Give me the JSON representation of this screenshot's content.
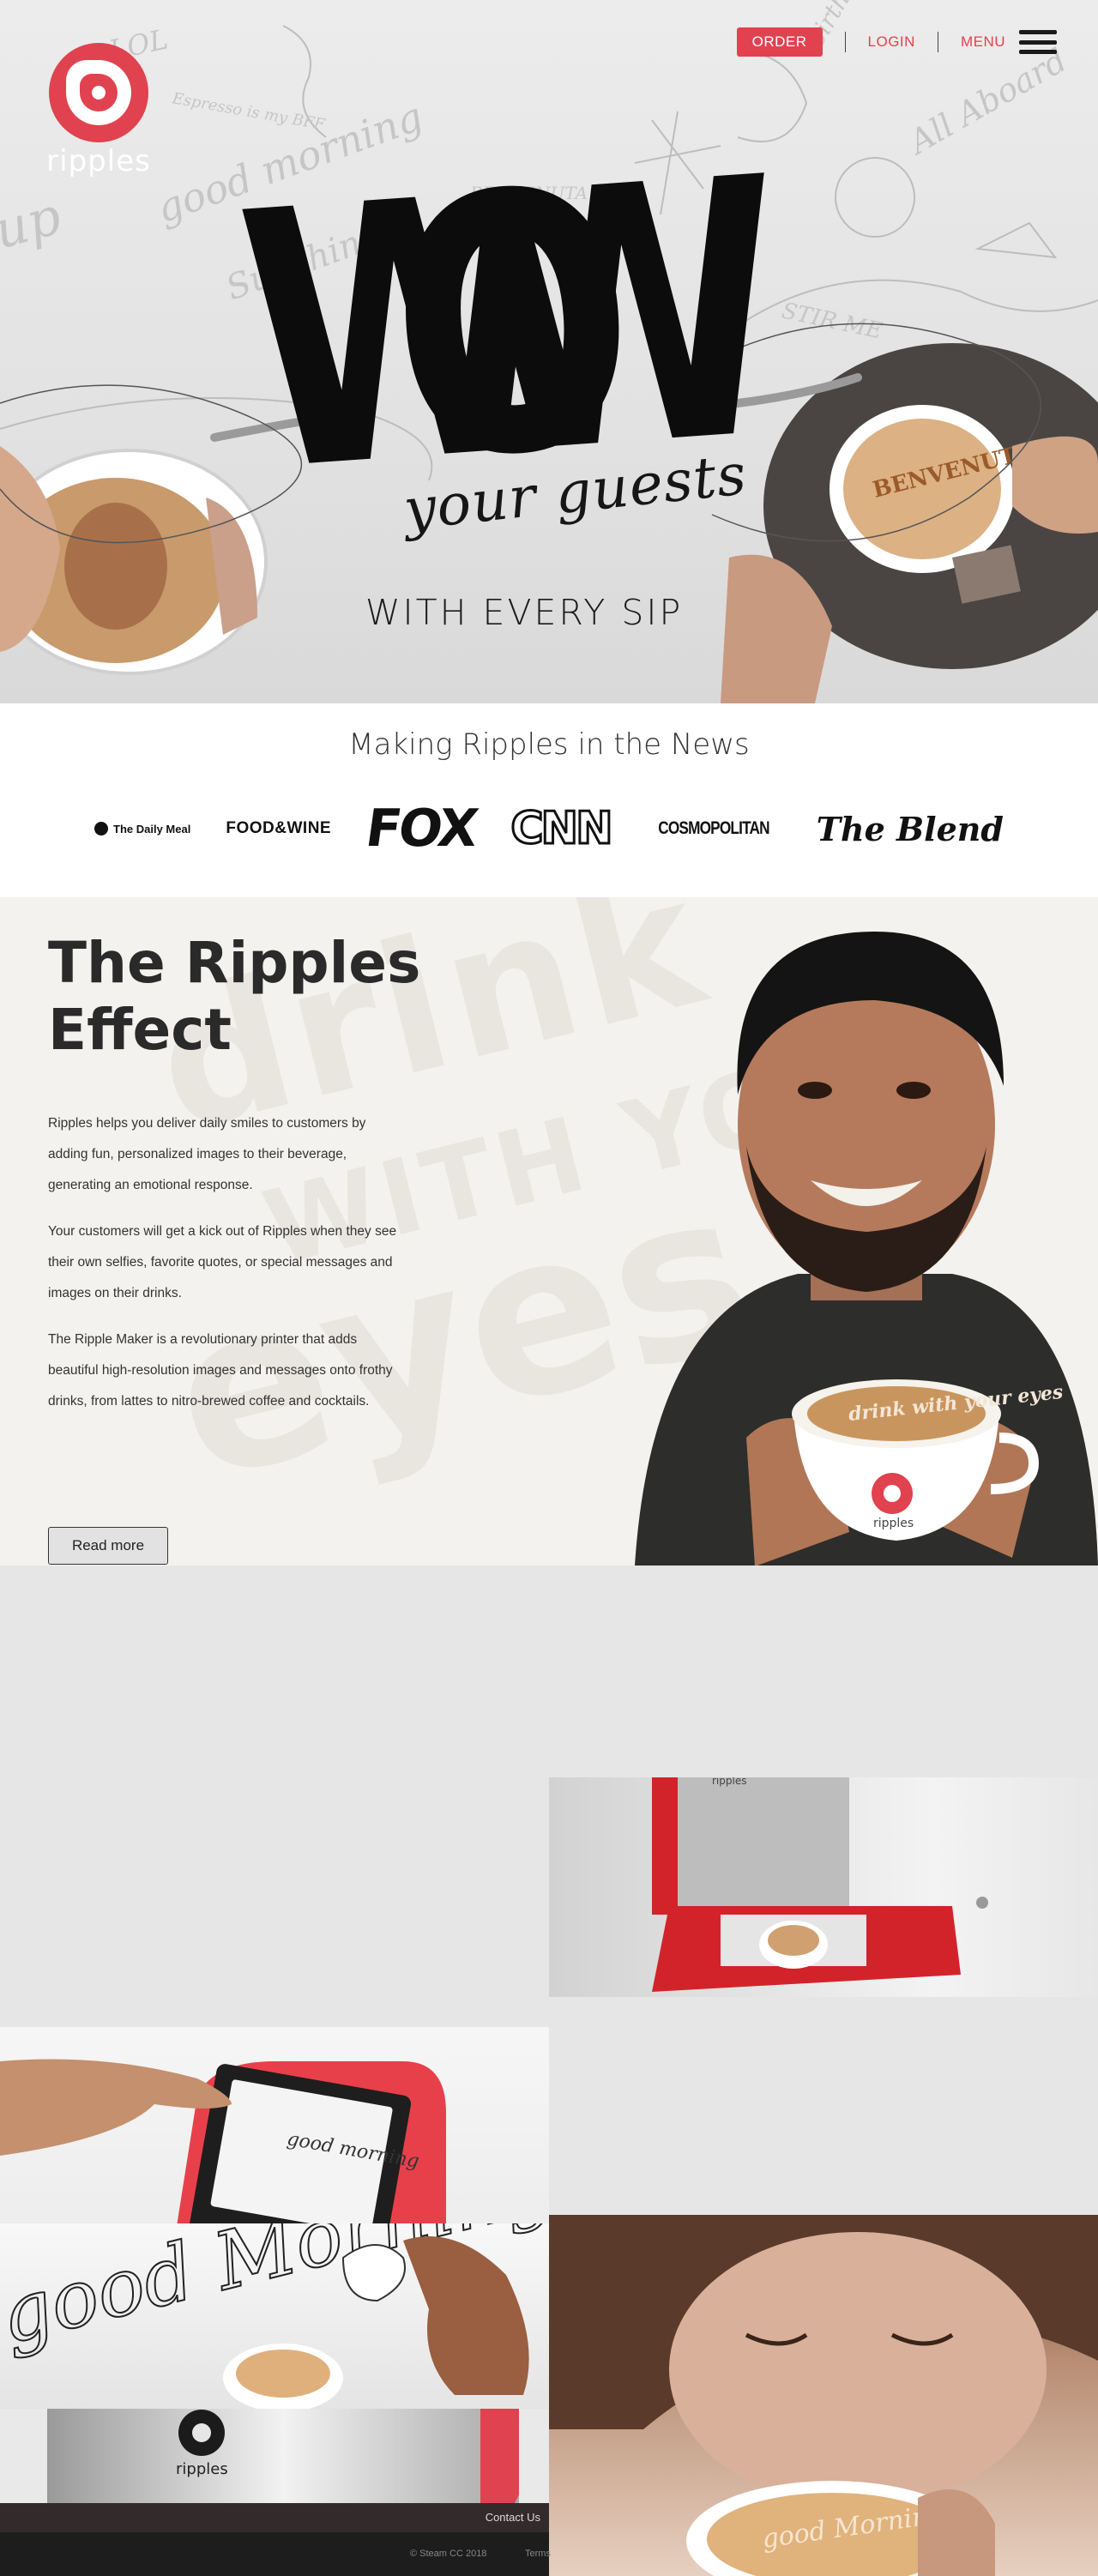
{
  "nav": {
    "logo_text": "ripples",
    "order_label": "ORDER",
    "login_label": "LOGIN",
    "menu_label": "MENU"
  },
  "hero": {
    "headline": "WOW",
    "script_line": "your guests",
    "subline": "WITH EVERY SIP",
    "cup_right_text": "BENVENUTA",
    "doodle_texts": [
      "LOL",
      "good morning",
      "Sunshine",
      "BENVENUTA",
      "Birthday",
      "All Aboard",
      "STIR ME",
      "up",
      "Espresso is my BFF"
    ]
  },
  "news": {
    "title": "Making Ripples in the News",
    "outlets": [
      "The Daily Meal",
      "FOOD&WINE",
      "FOX",
      "CNN",
      "COSMOPOLITAN",
      "The Blend"
    ]
  },
  "effect": {
    "title": "The Ripples Effect",
    "background_words": [
      "drink",
      "WITH YOUR",
      "eyes"
    ],
    "paragraphs": [
      "Ripples helps you deliver daily smiles to customers by adding fun, personalized images to their beverage, generating an emotional response.",
      "Your customers will get a kick out of Ripples when they see their own selfies, favorite quotes, or special messages and images on their drinks.",
      "The Ripple Maker is a revolutionary printer that adds beautiful high-resolution images and messages onto frothy drinks, from lattes to nitro-brewed coffee and cocktails."
    ],
    "read_more_label": "Read more",
    "cup_text": "drink with your eyes",
    "cup_brand": "ripples"
  },
  "gallery": {
    "printer_brand": "ripples",
    "morning_text": "good Morning",
    "touch_screen_text": "good morning",
    "machine_brand": "ripples",
    "woman_cup_text": "good Morning"
  },
  "footer": {
    "contact_label": "Contact Us",
    "copyright": "© Steam CC 2018",
    "terms_label": "Terms"
  },
  "colors": {
    "brand_red": "#e0424f",
    "footer_dark": "#332b2b",
    "footer_bottom": "#1d1d1d"
  }
}
